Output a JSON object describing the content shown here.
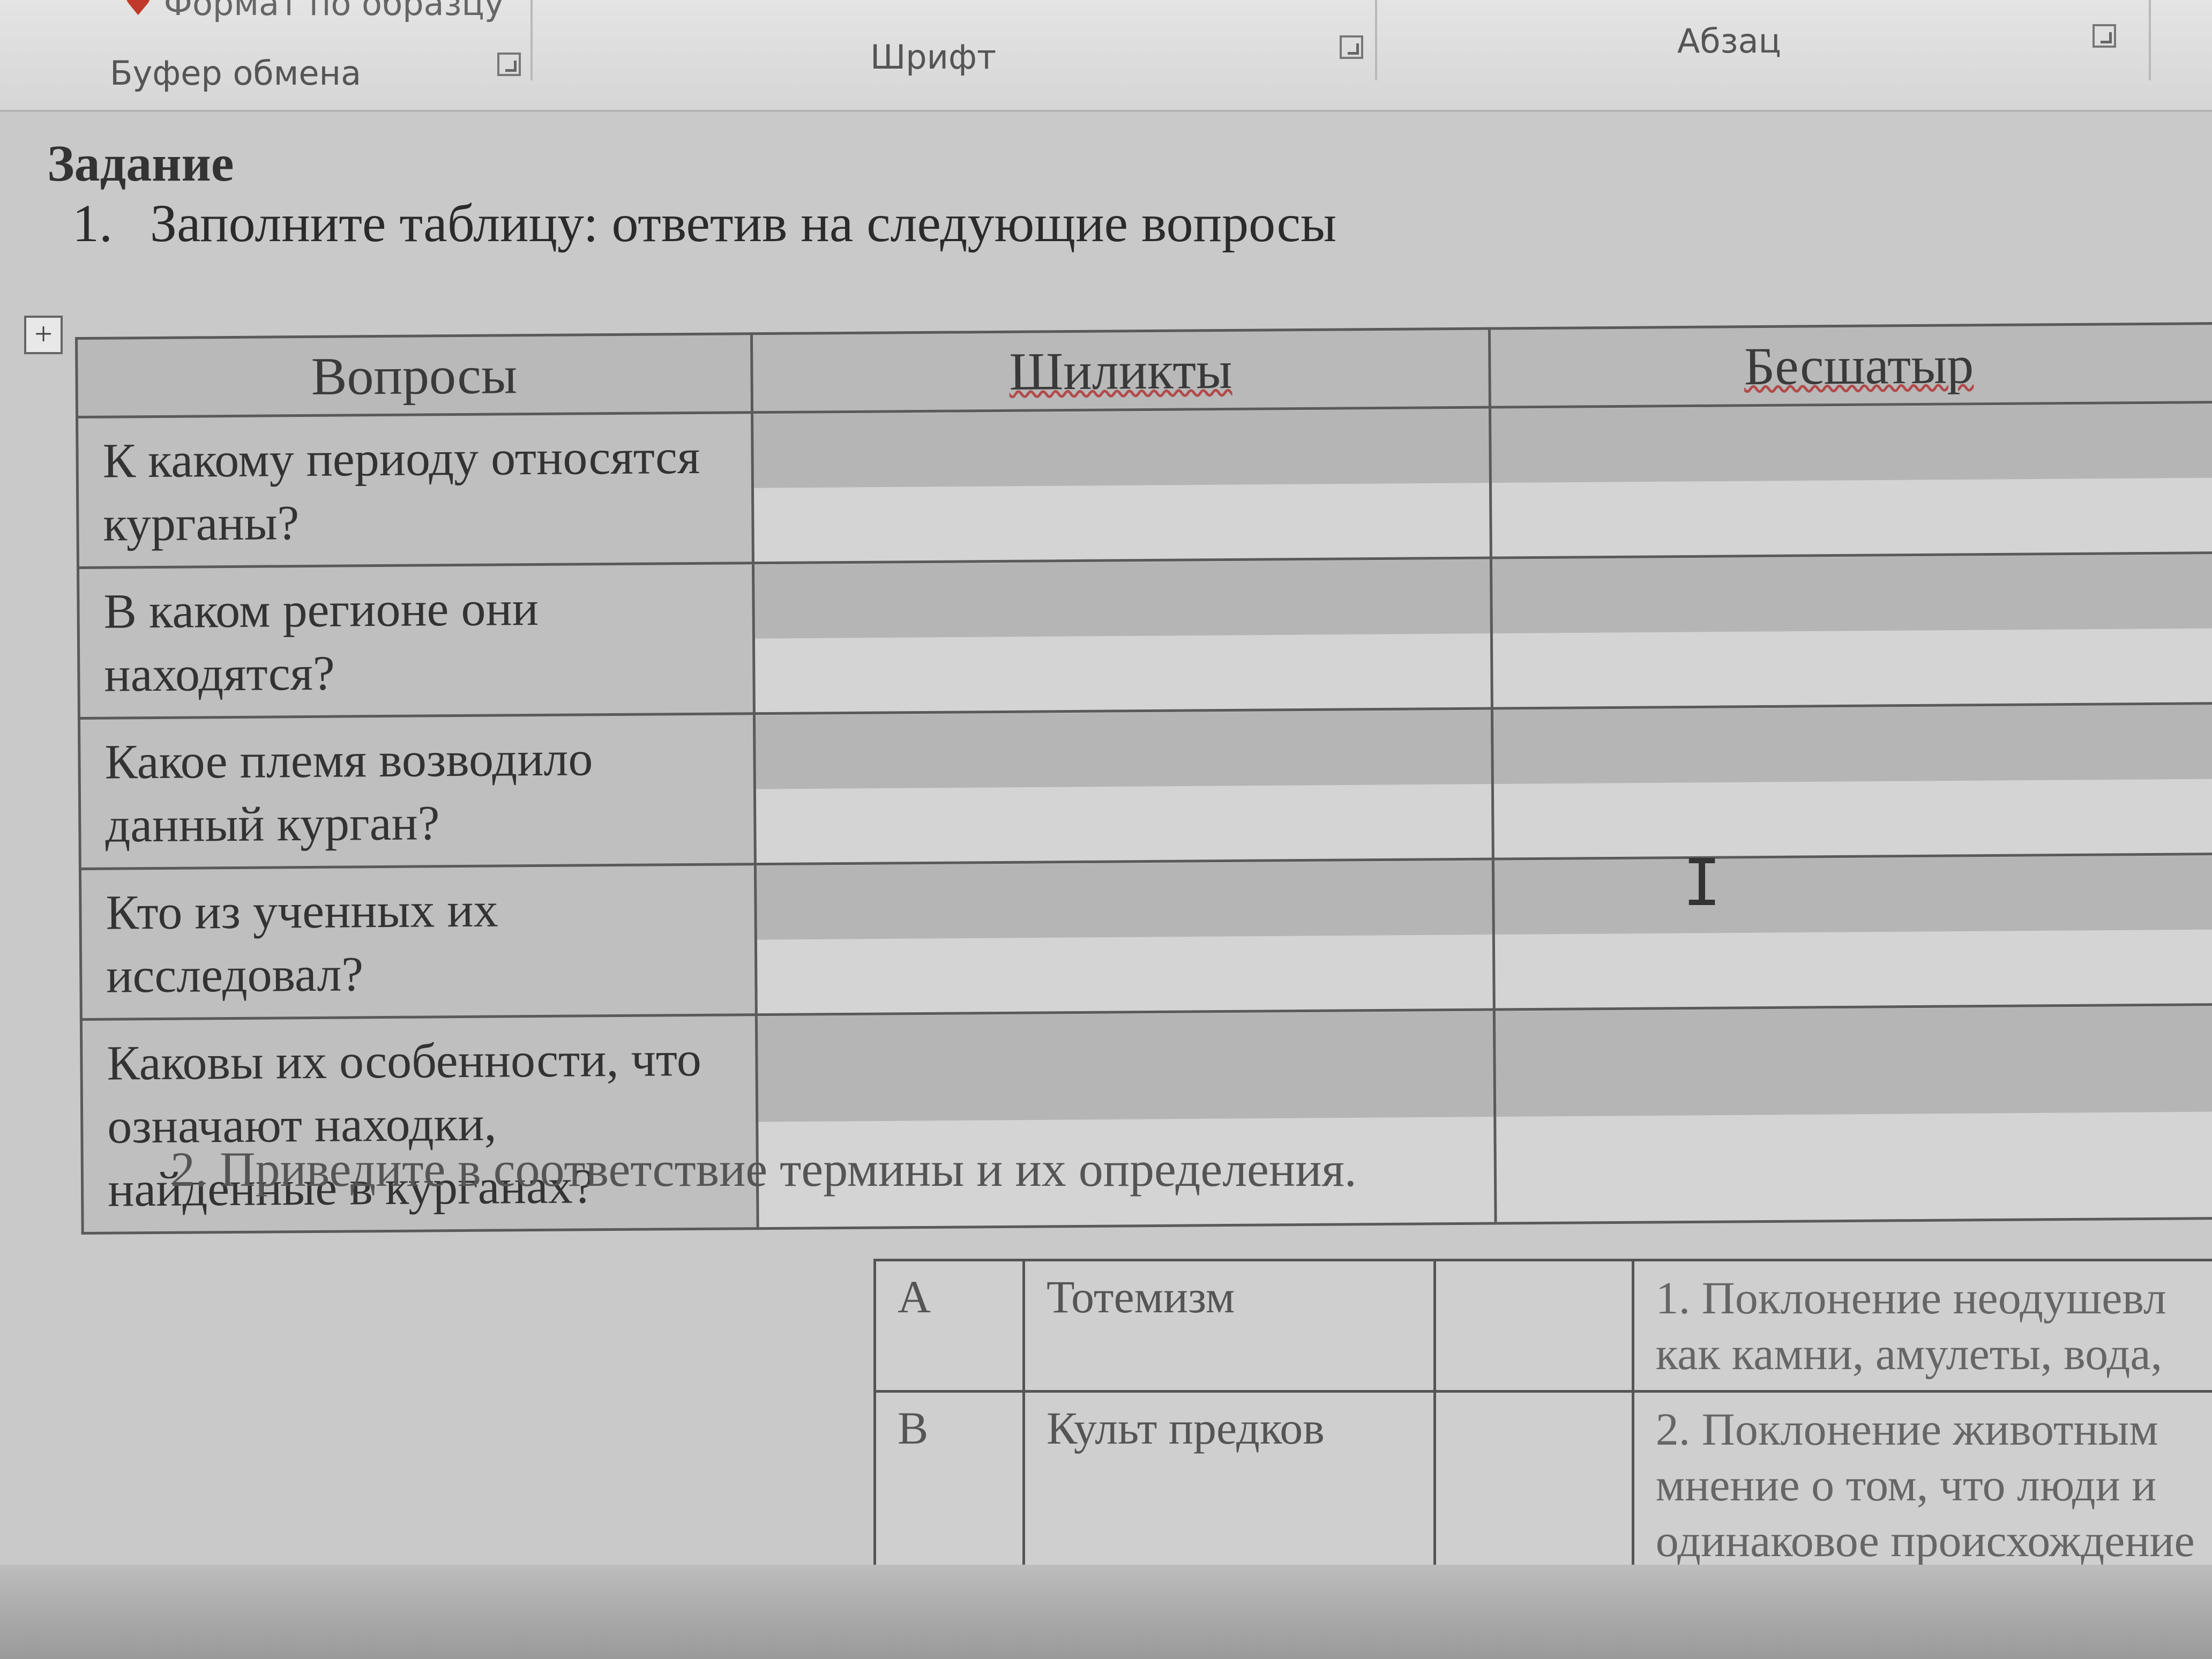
{
  "ribbon": {
    "format_painter": "Формат по образцу",
    "groups": [
      {
        "label": "Буфер обмена"
      },
      {
        "label": "Шрифт"
      },
      {
        "label": "Абзац"
      }
    ]
  },
  "document": {
    "heading": "Задание",
    "task1": {
      "number": "1.",
      "text": "Заполните таблицу: ответив на следующие вопросы"
    },
    "table1": {
      "headers": [
        "Вопросы",
        "Шиликты",
        "Бесшатыр"
      ],
      "rows": [
        "К какому периоду относятся курганы?",
        "В каком регионе они находятся?",
        "Какое племя возводило данный курган?",
        "Кто из ученных их исследовал?",
        "Каковы их особенности, что означают находки, найденные в курганах?"
      ]
    },
    "task2": {
      "text": "2. Приведите в соответствие термины и их определения."
    },
    "table2": {
      "rows": [
        {
          "letter": "A",
          "term": "Тотемизм",
          "definition": [
            "1. Поклонение неодушевл",
            "как камни, амулеты, вода,"
          ]
        },
        {
          "letter": "B",
          "term": "Культ предков",
          "definition": [
            "2. Поклонение животным",
            "мнение о том, что люди и",
            "одинаковое происхождение"
          ]
        }
      ]
    }
  }
}
